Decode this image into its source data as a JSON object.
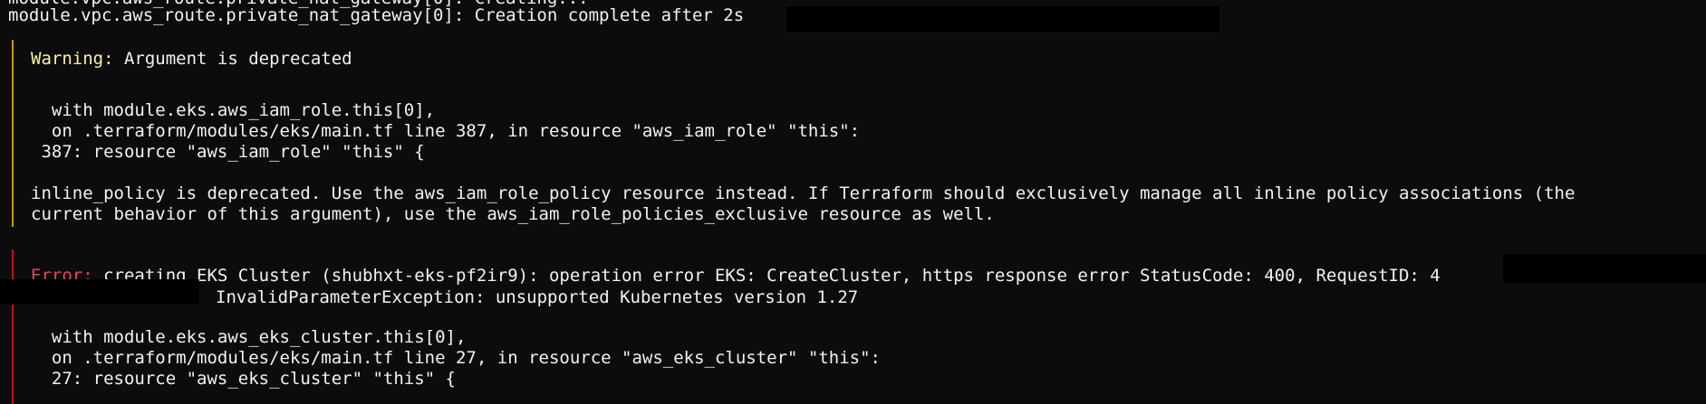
{
  "colors": {
    "background": "#0c0c0c",
    "text": "#f2f2f2",
    "warning_label": "#f9f1a5",
    "warning_bar": "#c19c00",
    "error_label": "#e74856",
    "error_bar": "#c50f1f",
    "redaction": "#000000"
  },
  "terminal": {
    "top_partial": "module.vpc.aws_route.private_nat_gateway[0]: Creating...",
    "creation_complete": "module.vpc.aws_route.private_nat_gateway[0]: Creation complete after 2s",
    "warning": {
      "label": "Warning:",
      "title": " Argument is deprecated",
      "with_line": "  with module.eks.aws_iam_role.this[0],",
      "on_line": "  on .terraform/modules/eks/main.tf line 387, in resource \"aws_iam_role\" \"this\":",
      "code_line": " 387: resource \"aws_iam_role\" \"this\" {",
      "detail_1": "inline_policy is deprecated. Use the aws_iam_role_policy resource instead. If Terraform should exclusively manage all inline policy associations (the",
      "detail_2": "current behavior of this argument), use the aws_iam_role_policies_exclusive resource as well."
    },
    "error": {
      "label": "Error:",
      "message_1": " creating EKS Cluster (shubhxt-eks-pf2ir9): operation error EKS: CreateCluster, https response error StatusCode: 400, RequestID: 4",
      "message_2": "InvalidParameterException: unsupported Kubernetes version 1.27",
      "with_line": "  with module.eks.aws_eks_cluster.this[0],",
      "on_line": "  on .terraform/modules/eks/main.tf line 27, in resource \"aws_eks_cluster\" \"this\":",
      "code_line": "  27: resource \"aws_eks_cluster\" \"this\" {"
    }
  }
}
